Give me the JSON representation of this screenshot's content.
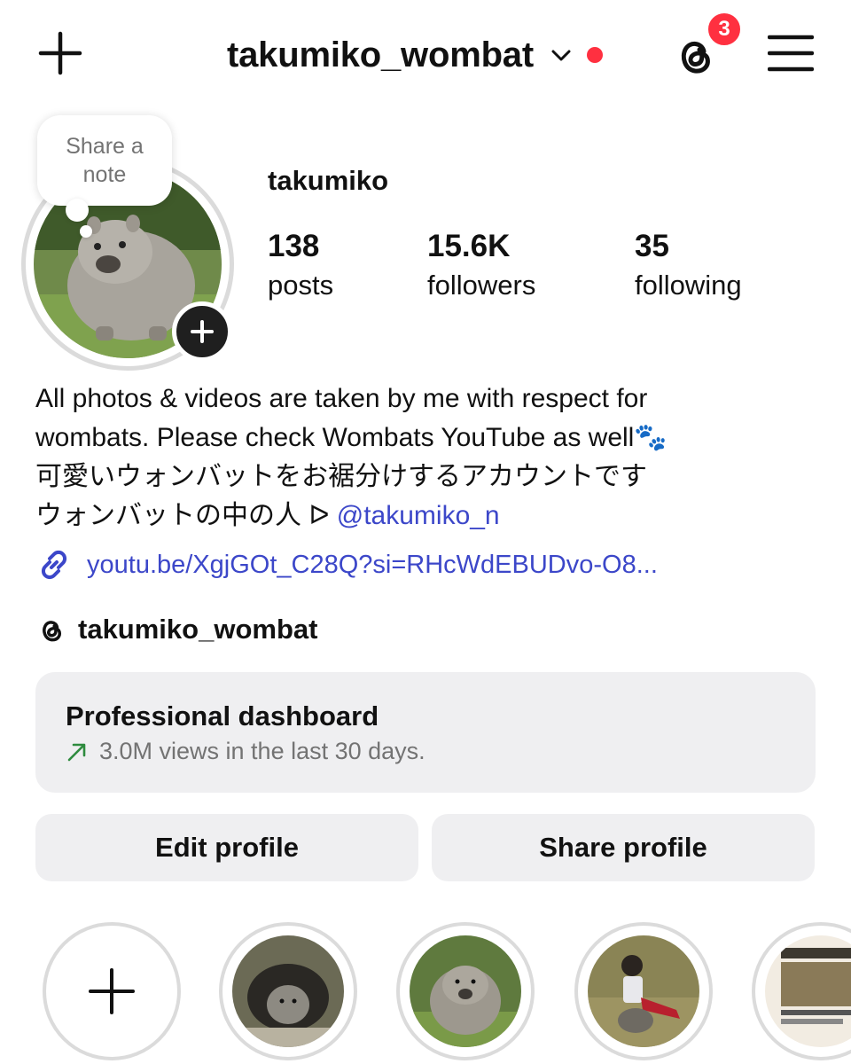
{
  "header": {
    "username": "takumiko_wombat",
    "notification_count": "3",
    "accent_color": "#ff3040"
  },
  "profile": {
    "note_prompt": "Share a\nnote",
    "display_name": "takumiko",
    "stats": [
      {
        "value": "138",
        "label": "posts"
      },
      {
        "value": "15.6K",
        "label": "followers"
      },
      {
        "value": "35",
        "label": "following"
      }
    ]
  },
  "bio": {
    "line1": "All photos & videos are taken by me with respect for",
    "line2": "wombats. Please check Wombats YouTube as well🐾",
    "line3": "可愛いウォンバットをお裾分けするアカウントです",
    "line4_prefix": "ウォンバットの中の人 ᐅ ",
    "mention": "@takumiko_n",
    "link": "youtu.be/XgjGOt_C28Q?si=RHcWdEBUDvo-O8...",
    "threads_handle": "takumiko_wombat",
    "link_color": "#3c47c9"
  },
  "dashboard": {
    "title": "Professional dashboard",
    "subtitle": "3.0M views in the last 30 days."
  },
  "buttons": {
    "edit": "Edit profile",
    "share": "Share profile"
  },
  "highlights": [
    {
      "name": "new",
      "icon": "plus-icon"
    },
    {
      "name": "burrow-photo"
    },
    {
      "name": "wombat-portrait"
    },
    {
      "name": "person-with-wombat"
    },
    {
      "name": "youtube-channel"
    }
  ]
}
